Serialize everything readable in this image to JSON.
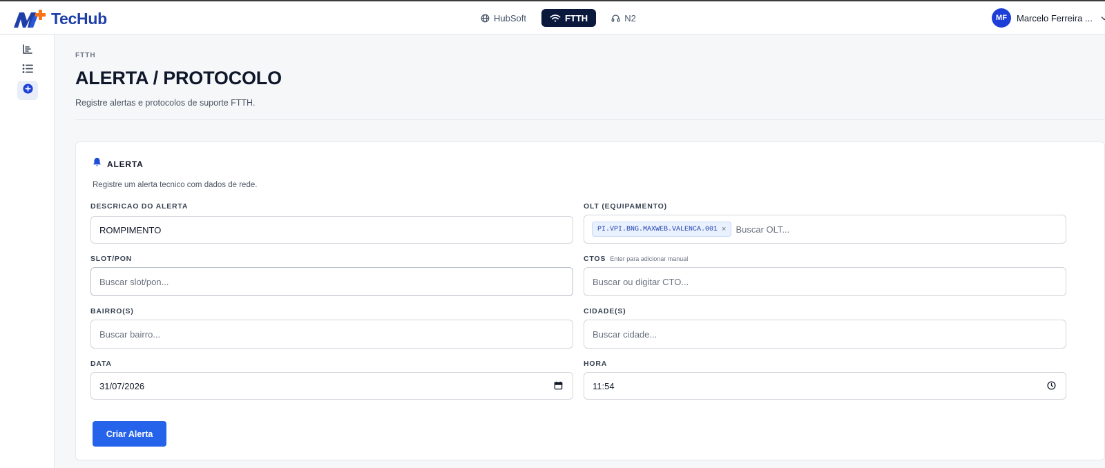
{
  "app": {
    "name": "TecHub"
  },
  "nav": {
    "items": [
      {
        "label": "HubSoft",
        "icon": "globe-icon",
        "active": false
      },
      {
        "label": "FTTH",
        "icon": "wifi-icon",
        "active": true
      },
      {
        "label": "N2",
        "icon": "headset-icon",
        "active": false
      }
    ]
  },
  "user": {
    "initials": "MF",
    "name": "Marcelo Ferreira ..."
  },
  "sidebar": {
    "items": [
      {
        "icon": "chart-bar-icon",
        "active": false
      },
      {
        "icon": "list-icon",
        "active": false
      },
      {
        "icon": "plus-circle-icon",
        "active": true
      }
    ]
  },
  "page": {
    "breadcrumb": "FTTH",
    "title": "ALERTA / PROTOCOLO",
    "subtitle": "Registre alertas e protocolos de suporte FTTH."
  },
  "card": {
    "title": "ALERTA",
    "subtitle": "Registre um alerta tecnico com dados de rede.",
    "fields": {
      "descricao": {
        "label": "DESCRICAO DO ALERTA",
        "value": "ROMPIMENTO"
      },
      "olt": {
        "label": "OLT (EQUIPAMENTO)",
        "chip": "PI.VPI.BNG.MAXWEB.VALENCA.001",
        "placeholder": "Buscar OLT..."
      },
      "slot": {
        "label": "SLOT/PON",
        "placeholder": "Buscar slot/pon..."
      },
      "ctos": {
        "label": "CTOS",
        "hint": "Enter para adicionar manual",
        "placeholder": "Buscar ou digitar CTO..."
      },
      "bairro": {
        "label": "BAIRRO(S)",
        "placeholder": "Buscar bairro..."
      },
      "cidade": {
        "label": "CIDADE(S)",
        "placeholder": "Buscar cidade..."
      },
      "data": {
        "label": "DATA",
        "value": "31/07/2026"
      },
      "hora": {
        "label": "HORA",
        "value": "11:54"
      }
    },
    "submit_label": "Criar Alerta"
  },
  "colors": {
    "brand": "#1f3fa8",
    "nav_active": "#0b1a3c",
    "primary_button": "#2563eb",
    "accent": "#1d3fd8",
    "chip_bg": "#eaf1fe"
  }
}
